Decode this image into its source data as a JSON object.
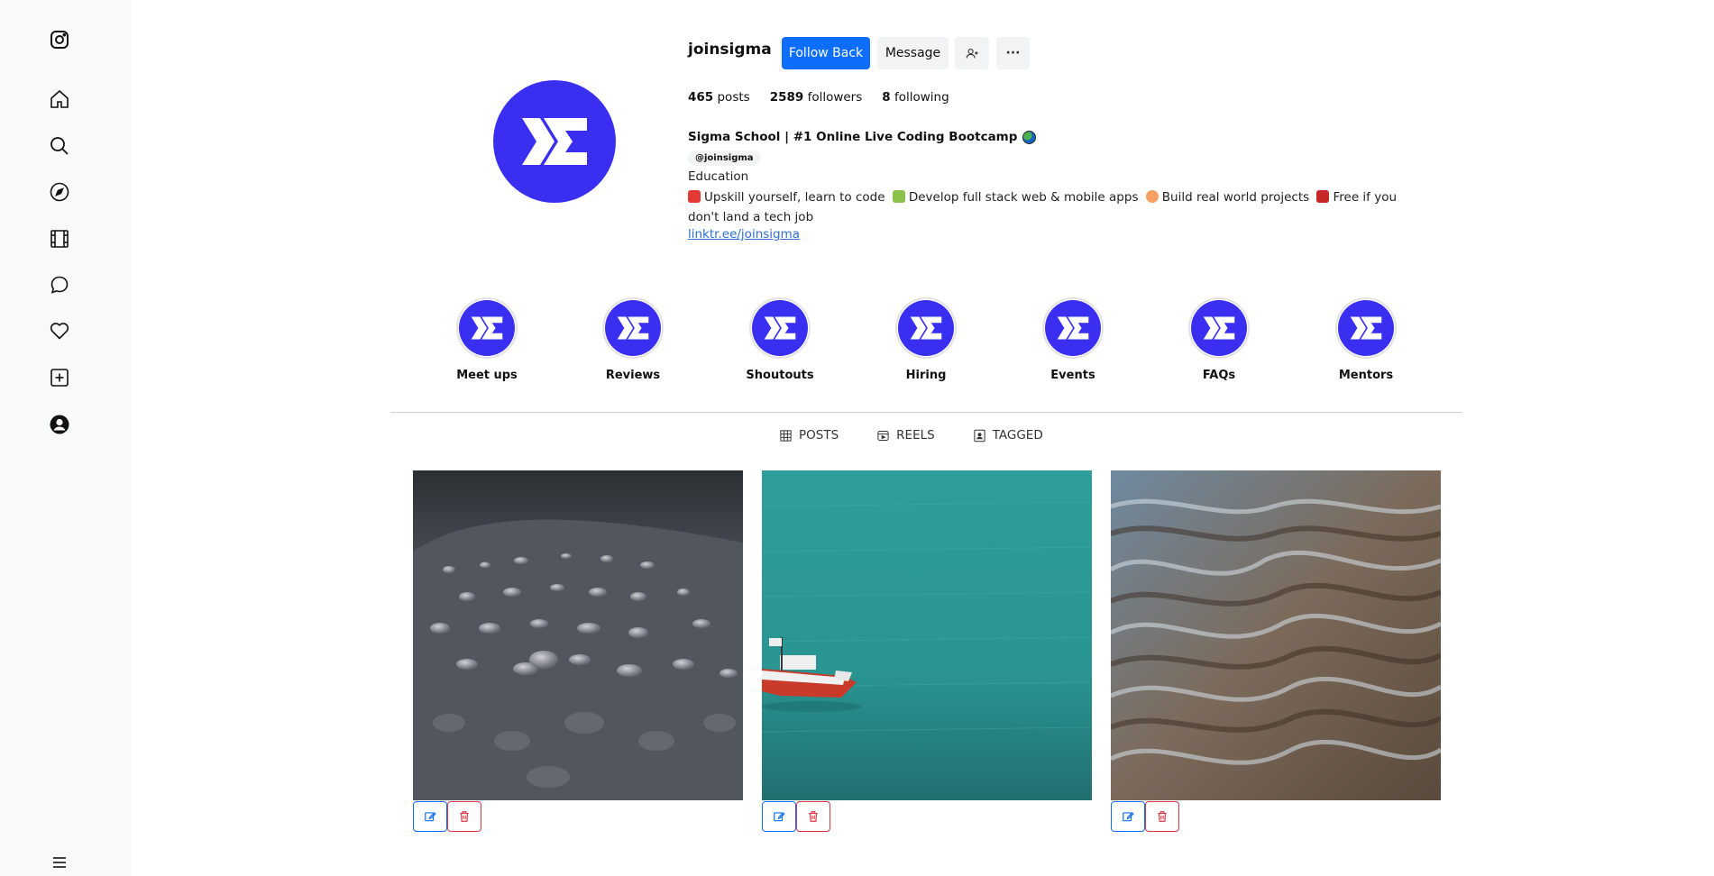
{
  "sidebar": {
    "icons": [
      "instagram-icon",
      "home-icon",
      "search-icon",
      "explore-icon",
      "reels-icon",
      "messages-icon",
      "notifications-icon",
      "create-icon",
      "profile-icon",
      "menu-icon"
    ]
  },
  "profile": {
    "username": "joinsigma",
    "follow_back_label": "Follow Back",
    "message_label": "Message",
    "more_label": "···",
    "stats": {
      "posts_count": "465",
      "posts_label": "posts",
      "followers_count": "2589",
      "followers_label": "followers",
      "following_count": "8",
      "following_label": "following"
    },
    "full_name": "Sigma School | #1 Online Live Coding Bootcamp",
    "handle_badge": "@joinsigma",
    "category": "Education",
    "bio": {
      "part1": "Upskill yourself, learn to code",
      "part2": "Develop full stack web & mobile apps",
      "part3": "Build real world projects",
      "part4": "Free if you don't land a tech job"
    },
    "link": "linktr.ee/joinsigma"
  },
  "highlights": [
    "Meet ups",
    "Reviews",
    "Shoutouts",
    "Hiring",
    "Events",
    "FAQs",
    "Mentors"
  ],
  "tabs": {
    "posts": "POSTS",
    "reels": "REELS",
    "tagged": "TAGGED"
  },
  "posts": [
    {
      "subject": "water-droplets-photo"
    },
    {
      "subject": "red-boat-on-sea-photo"
    },
    {
      "subject": "rippled-water-photo"
    }
  ],
  "colors": {
    "brand": "#3a2ff0",
    "primary": "#0d6efd",
    "danger": "#dc3545",
    "link": "#2f6fd6"
  }
}
